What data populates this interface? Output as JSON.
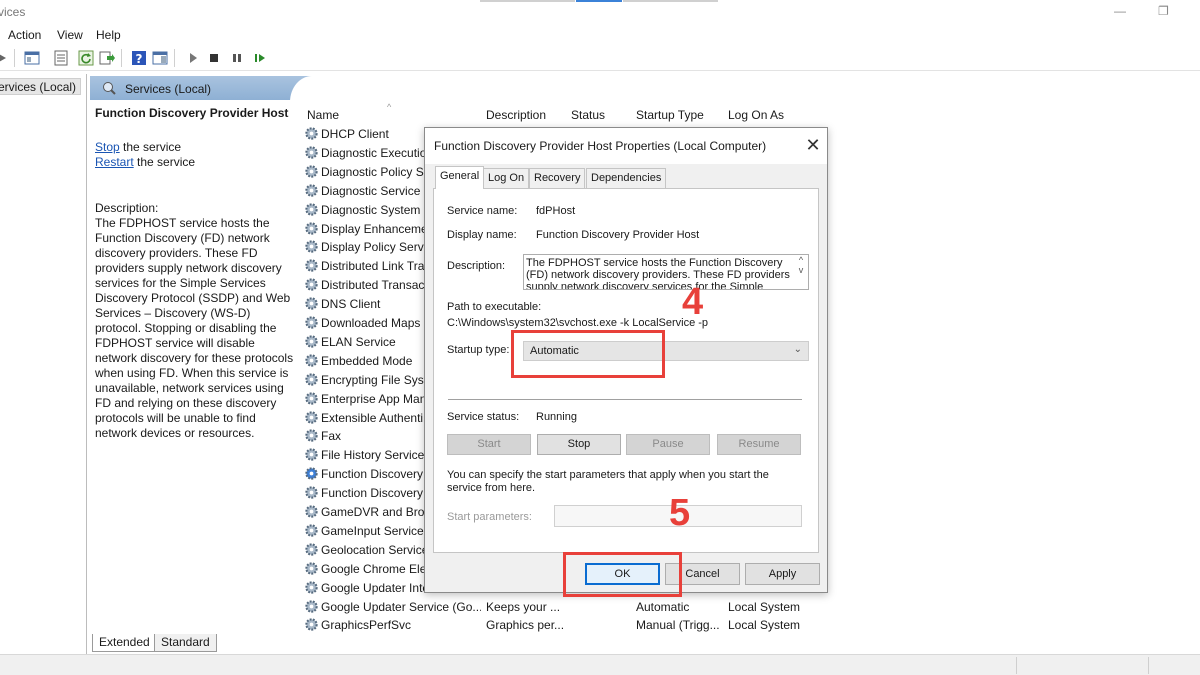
{
  "window": {
    "title": "vices"
  },
  "menu": [
    "Action",
    "View",
    "Help"
  ],
  "tree": {
    "root": "ervices (Local)"
  },
  "panel": {
    "header": "Services (Local)",
    "selected_title": "Function Discovery Provider Host",
    "actions": [
      {
        "link": "Stop",
        "rest": " the service"
      },
      {
        "link": "Restart",
        "rest": " the service"
      }
    ],
    "description_label": "Description:",
    "description": "The FDPHOST service hosts the Function Discovery (FD) network discovery providers. These FD providers supply network discovery services for the Simple Services Discovery Protocol (SSDP) and Web Services – Discovery (WS-D) protocol. Stopping or disabling the FDPHOST service will disable network discovery for these protocols when using FD. When this service is unavailable, network services using FD and relying on these discovery protocols will be unable to find network devices or resources."
  },
  "list": {
    "columns": [
      "Name",
      "Description",
      "Status",
      "Startup Type",
      "Log On As"
    ],
    "rows": [
      {
        "name": "DHCP Client",
        "desc": "",
        "status": "",
        "startup": "",
        "logon": ""
      },
      {
        "name": "Diagnostic Execution",
        "desc": "",
        "status": "",
        "startup": "",
        "logon": ""
      },
      {
        "name": "Diagnostic Policy Se",
        "desc": "",
        "status": "",
        "startup": "",
        "logon": ""
      },
      {
        "name": "Diagnostic Service H",
        "desc": "",
        "status": "",
        "startup": "",
        "logon": ""
      },
      {
        "name": "Diagnostic System H",
        "desc": "",
        "status": "",
        "startup": "",
        "logon": ""
      },
      {
        "name": "Display Enhanceme",
        "desc": "",
        "status": "",
        "startup": "",
        "logon": ""
      },
      {
        "name": "Display Policy Servi",
        "desc": "",
        "status": "",
        "startup": "",
        "logon": ""
      },
      {
        "name": "Distributed Link Tra",
        "desc": "",
        "status": "",
        "startup": "",
        "logon": ""
      },
      {
        "name": "Distributed Transact",
        "desc": "",
        "status": "",
        "startup": "",
        "logon": ""
      },
      {
        "name": "DNS Client",
        "desc": "",
        "status": "",
        "startup": "",
        "logon": ""
      },
      {
        "name": "Downloaded Maps N",
        "desc": "",
        "status": "",
        "startup": "",
        "logon": ""
      },
      {
        "name": "ELAN Service",
        "desc": "",
        "status": "",
        "startup": "",
        "logon": ""
      },
      {
        "name": "Embedded Mode",
        "desc": "",
        "status": "",
        "startup": "",
        "logon": ""
      },
      {
        "name": "Encrypting File Syst",
        "desc": "",
        "status": "",
        "startup": "",
        "logon": ""
      },
      {
        "name": "Enterprise App Man",
        "desc": "",
        "status": "",
        "startup": "",
        "logon": ""
      },
      {
        "name": "Extensible Authenti",
        "desc": "",
        "status": "",
        "startup": "",
        "logon": ""
      },
      {
        "name": "Fax",
        "desc": "",
        "status": "",
        "startup": "",
        "logon": ""
      },
      {
        "name": "File History Service",
        "desc": "",
        "status": "",
        "startup": "",
        "logon": ""
      },
      {
        "name": "Function Discovery",
        "desc": "",
        "status": "",
        "startup": "",
        "logon": ""
      },
      {
        "name": "Function Discovery",
        "desc": "",
        "status": "",
        "startup": "",
        "logon": ""
      },
      {
        "name": "GameDVR and Broa",
        "desc": "",
        "status": "",
        "startup": "",
        "logon": ""
      },
      {
        "name": "GameInput Service",
        "desc": "",
        "status": "",
        "startup": "",
        "logon": ""
      },
      {
        "name": "Geolocation Service",
        "desc": "",
        "status": "",
        "startup": "",
        "logon": ""
      },
      {
        "name": "Google Chrome Elev",
        "desc": "",
        "status": "",
        "startup": "",
        "logon": ""
      },
      {
        "name": "Google Updater Inte",
        "desc": "",
        "status": "",
        "startup": "",
        "logon": ""
      },
      {
        "name": "Google Updater Service (Go...",
        "desc": "Keeps your ...",
        "status": "",
        "startup": "Automatic",
        "logon": "Local System"
      },
      {
        "name": "GraphicsPerfSvc",
        "desc": "Graphics per...",
        "status": "",
        "startup": "Manual (Trigg...",
        "logon": "Local System"
      }
    ]
  },
  "bottom_tabs": [
    "Extended",
    "Standard"
  ],
  "dialog": {
    "title": "Function Discovery Provider Host Properties (Local Computer)",
    "tabs": [
      "General",
      "Log On",
      "Recovery",
      "Dependencies"
    ],
    "service_name_label": "Service name:",
    "service_name": "fdPHost",
    "display_name_label": "Display name:",
    "display_name": "Function Discovery Provider Host",
    "description_label": "Description:",
    "description": "The FDPHOST service hosts the Function Discovery (FD) network discovery providers. These FD providers supply network discovery services for the Simple",
    "path_label": "Path to executable:",
    "path": "C:\\Windows\\system32\\svchost.exe -k LocalService -p",
    "startup_label": "Startup type:",
    "startup_value": "Automatic",
    "status_label": "Service status:",
    "status_value": "Running",
    "buttons": {
      "start": "Start",
      "stop": "Stop",
      "pause": "Pause",
      "resume": "Resume"
    },
    "params_help": "You can specify the start parameters that apply when you start the service from here.",
    "params_label": "Start parameters:",
    "ok": "OK",
    "cancel": "Cancel",
    "apply": "Apply"
  },
  "annotations": {
    "step4": "4",
    "step5": "5"
  },
  "colors": {
    "annotation": "#e8403a",
    "link": "#1a55b3",
    "header": "#a9c3df"
  }
}
